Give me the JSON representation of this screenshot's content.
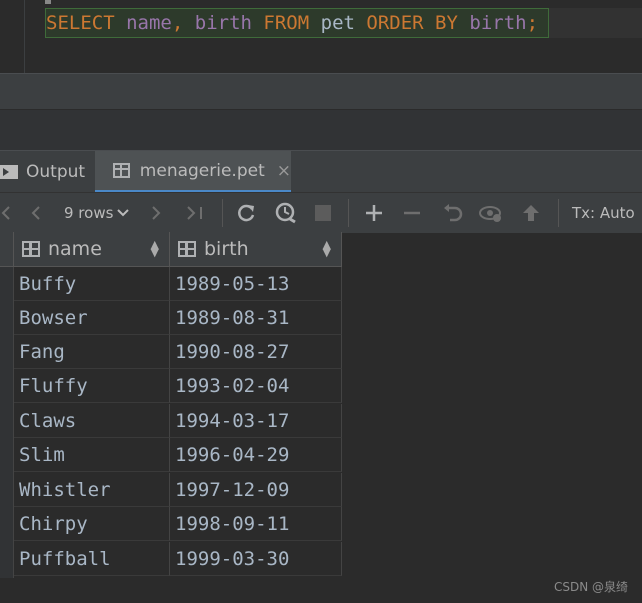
{
  "editor": {
    "sql": {
      "select": "SELECT",
      "col1": "name",
      "comma": ",",
      "col2": "birth",
      "from": "FROM",
      "table": "pet",
      "order_by": "ORDER BY",
      "col3": "birth",
      "semicolon": ";"
    }
  },
  "tabs": [
    {
      "label": "Output",
      "icon": "output-icon"
    },
    {
      "label": "menagerie.pet",
      "icon": "table-icon",
      "close": "×"
    }
  ],
  "toolbar": {
    "rows_label": "9 rows",
    "tx_label": "Tx: Auto",
    "icons": [
      "first-page-icon",
      "prev-page-icon",
      "rows-dropdown",
      "next-page-icon",
      "last-page-icon",
      "refresh-icon",
      "history-icon",
      "stop-icon",
      "add-row-icon",
      "remove-row-icon",
      "revert-icon",
      "view-icon",
      "submit-icon"
    ]
  },
  "grid": {
    "columns": [
      "name",
      "birth"
    ],
    "rows": [
      [
        "Buffy",
        "1989-05-13"
      ],
      [
        "Bowser",
        "1989-08-31"
      ],
      [
        "Fang",
        "1990-08-27"
      ],
      [
        "Fluffy",
        "1993-02-04"
      ],
      [
        "Claws",
        "1994-03-17"
      ],
      [
        "Slim",
        "1996-04-29"
      ],
      [
        "Whistler",
        "1997-12-09"
      ],
      [
        "Chirpy",
        "1998-09-11"
      ],
      [
        "Puffball",
        "1999-03-30"
      ]
    ]
  },
  "watermark": "CSDN @泉绮",
  "colors": {
    "keyword": "#cc7832",
    "column": "#9876aa",
    "text": "#a9b7c6",
    "background": "#2b2b2b",
    "accent_tab": "#4a88c7"
  }
}
